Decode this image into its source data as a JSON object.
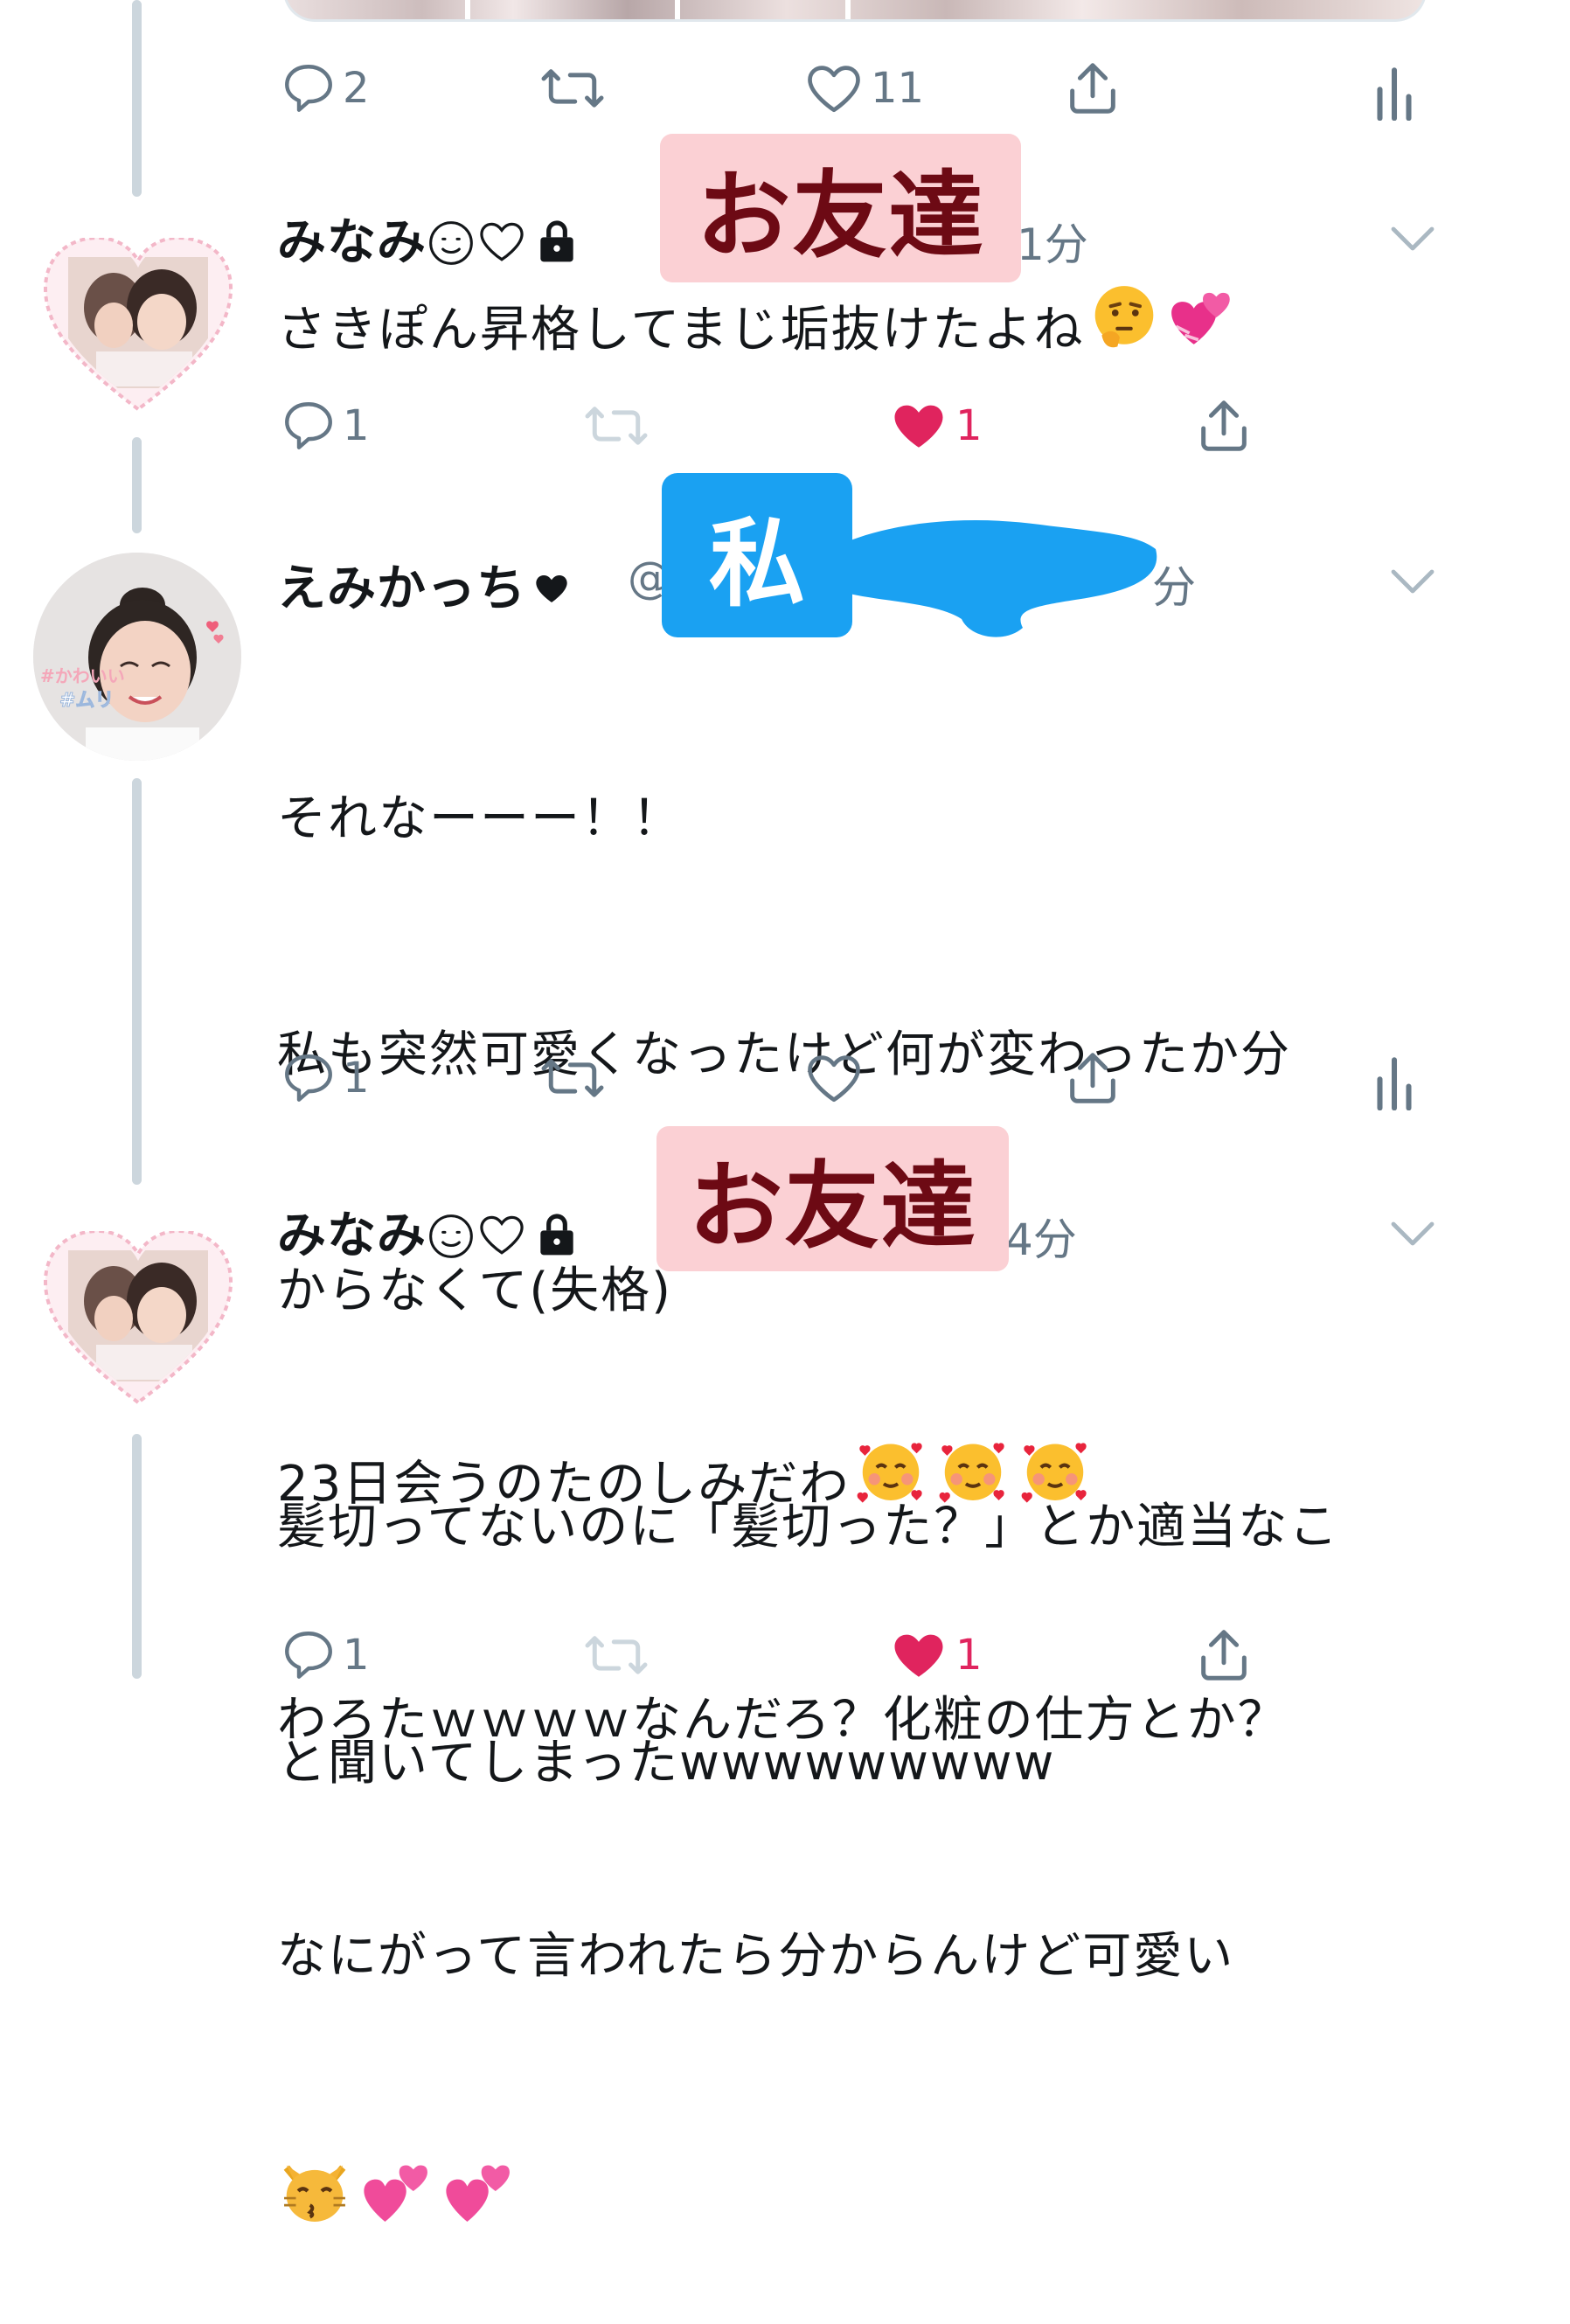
{
  "tweets": [
    {
      "actions": {
        "reply_count": "2",
        "like_count": "11"
      }
    },
    {
      "display_name": "みなみ",
      "time": "1分",
      "text": "さきぽん昇格してまじ垢抜けたよね",
      "actions": {
        "reply_count": "1",
        "like_count": "1",
        "liked": true
      }
    },
    {
      "display_name": "えみかっち",
      "handle_prefix": "@",
      "time": "分",
      "avatar_tags": [
        "#かわいい",
        "#ムリ"
      ],
      "text_lines": [
        "それなーーー！！",
        "私も突然可愛くなったけど何が変わったか分",
        "からなくて(失格)",
        "髪切ってないのに「髪切った？」とか適当なこ",
        "と聞いてしまったwwwwwwwww"
      ],
      "actions": {
        "reply_count": "1",
        "like_count": ""
      }
    },
    {
      "display_name": "みなみ",
      "time": "4分",
      "text_lines": [
        "23日会うのたのしみだわ",
        "わろたｗｗｗｗなんだろ？化粧の仕方とか？",
        "なにがって言われたら分からんけど可愛い"
      ],
      "actions": {
        "reply_count": "1",
        "like_count": "1",
        "liked": true
      }
    }
  ],
  "annotations": {
    "friend_label": "お友達",
    "me_label": "私"
  },
  "colors": {
    "like_red": "#e0245e",
    "icon_gray": "#657786",
    "thread_line": "#ccd6dd",
    "friend_label_bg": "#fbd0d4",
    "friend_label_text": "#6d0a14",
    "me_label_bg": "#1aa1f2"
  }
}
